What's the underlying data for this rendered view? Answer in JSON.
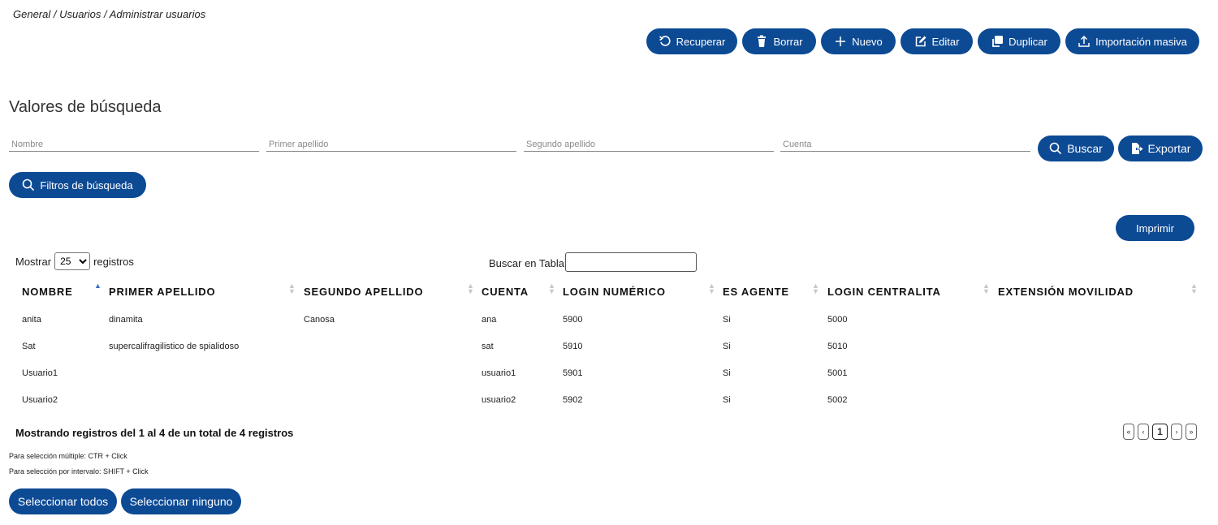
{
  "breadcrumb": "General / Usuarios / Administrar usuarios",
  "toolbar": {
    "recuperar": "Recuperar",
    "borrar": "Borrar",
    "nuevo": "Nuevo",
    "editar": "Editar",
    "duplicar": "Duplicar",
    "importacion": "Importación masiva"
  },
  "search": {
    "title": "Valores de búsqueda",
    "nombre_placeholder": "Nombre",
    "primer_apellido_placeholder": "Primer apellido",
    "segundo_apellido_placeholder": "Segundo apellido",
    "cuenta_placeholder": "Cuenta",
    "buscar": "Buscar",
    "exportar": "Exportar",
    "filtros": "Filtros de búsqueda"
  },
  "print": "Imprimir",
  "table_controls": {
    "mostrar": "Mostrar",
    "page_size": "25",
    "registros": "registros",
    "buscar_tabla": "Buscar en Tabla:"
  },
  "table": {
    "columns": [
      "NOMBRE",
      "PRIMER APELLIDO",
      "SEGUNDO APELLIDO",
      "CUENTA",
      "LOGIN NUMÉRICO",
      "ES AGENTE",
      "LOGIN CENTRALITA",
      "EXTENSIÓN MOVILIDAD"
    ],
    "rows": [
      [
        "anita",
        "dinamita",
        "Canosa",
        "ana",
        "5900",
        "Si",
        "5000",
        ""
      ],
      [
        "Sat",
        "supercalifragilistico de spialidoso",
        "",
        "sat",
        "5910",
        "Si",
        "5010",
        ""
      ],
      [
        "Usuario1",
        "",
        "",
        "usuario1",
        "5901",
        "Si",
        "5001",
        ""
      ],
      [
        "Usuario2",
        "",
        "",
        "usuario2",
        "5902",
        "Si",
        "5002",
        ""
      ]
    ]
  },
  "footer": {
    "info": "Mostrando registros del 1 al 4 de un total de 4 registros",
    "hint_multiple": "Para selección múltiple: CTR + Click",
    "hint_interval": "Para selección por intervalo: SHIFT + Click",
    "select_all": "Seleccionar todos",
    "select_none": "Seleccionar ninguno"
  },
  "pagination": {
    "first": "«",
    "prev": "‹",
    "current": "1",
    "next": "›",
    "last": "»"
  },
  "colors": {
    "primary": "#0d4a94"
  }
}
